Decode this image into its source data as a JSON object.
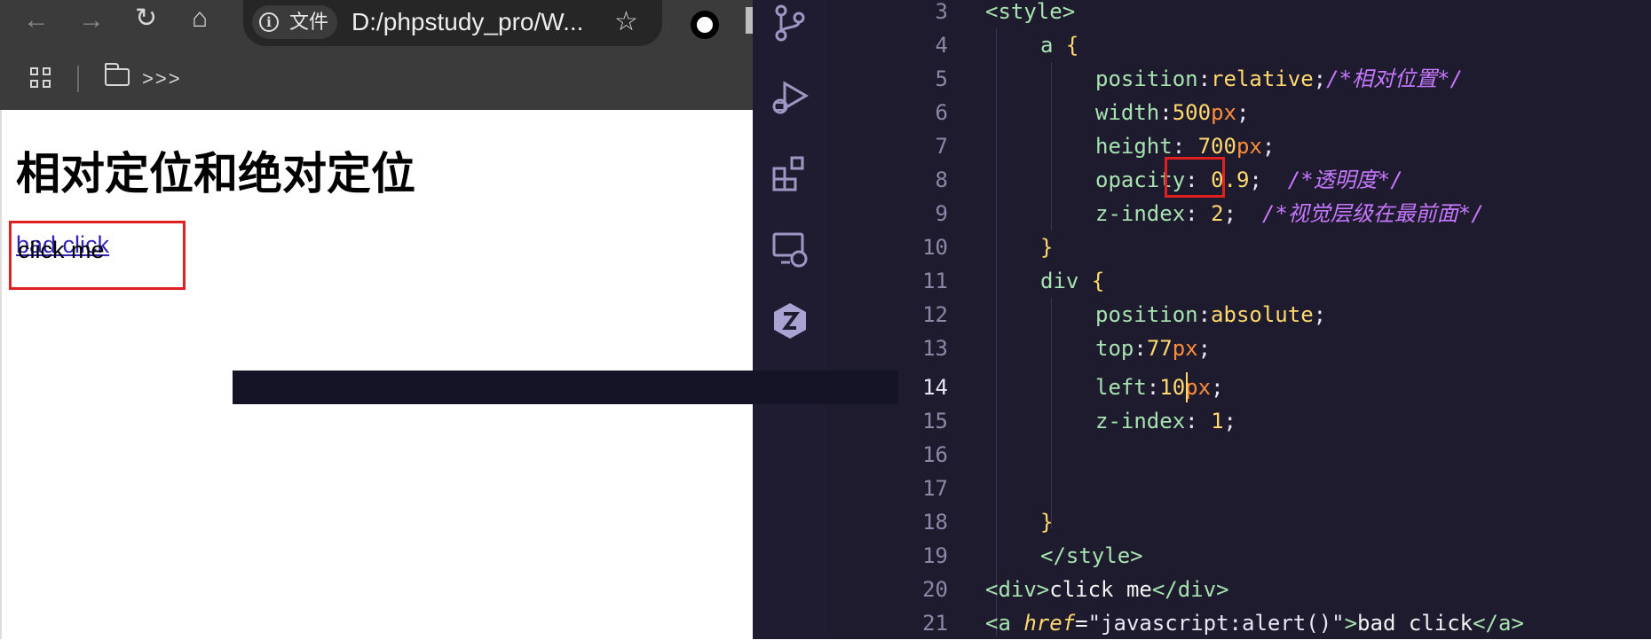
{
  "browser": {
    "address_bar": {
      "info_label": "文件",
      "url": "D:/phpstudy_pro/W..."
    },
    "bookmarks_bar": {
      "more_label": ">>>"
    },
    "page": {
      "heading": "相对定位和绝对定位",
      "link_text": "bad click",
      "div_text": "click me"
    }
  },
  "editor": {
    "line_numbers": [
      "3",
      "4",
      "5",
      "6",
      "7",
      "8",
      "9",
      "10",
      "11",
      "12",
      "13",
      "14",
      "15",
      "16",
      "17",
      "18",
      "19",
      "20",
      "21"
    ],
    "active_line": "14",
    "code": {
      "l3": {
        "tag": "<style>"
      },
      "l4": {
        "sel": "a",
        "brace": "{"
      },
      "l5": {
        "prop": "position",
        "val": "relative",
        "cmt": "/*相对位置*/"
      },
      "l6": {
        "prop": "width",
        "num": "500",
        "unit": "px"
      },
      "l7": {
        "prop": "height",
        "num": "700",
        "unit": "px"
      },
      "l8": {
        "prop": "opacity",
        "num": "0.9",
        "cmt": "/*透明度*/"
      },
      "l9": {
        "prop": "z-index",
        "num": "2",
        "cmt": "/*视觉层级在最前面*/"
      },
      "l10": {
        "brace": "}"
      },
      "l11": {
        "sel": "div",
        "brace": "{"
      },
      "l12": {
        "prop": "position",
        "val": "absolute"
      },
      "l13": {
        "prop": "top",
        "num": "77",
        "unit": "px"
      },
      "l14": {
        "prop": "left",
        "num": "10",
        "unit": "px"
      },
      "l15": {
        "prop": "z-index",
        "num": "1"
      },
      "l18": {
        "brace": "}"
      },
      "l19": {
        "tag": "</style>"
      },
      "l20": {
        "open": "<div>",
        "text": "click me",
        "close": "</div>"
      },
      "l21": {
        "open": "<a",
        "attr": "href",
        "eq": "=",
        "str": "\"javascript:alert()\"",
        "gt": ">",
        "text": "bad click",
        "close": "</a>"
      }
    }
  },
  "colors": {
    "editor_bg": "#1e1b2e",
    "keyword_green": "#a7e3b0",
    "number_yellow": "#ffd86e",
    "unit_orange": "#ff8d3a",
    "comment_purple": "#c678ff",
    "highlight_red": "#e02020",
    "link_blue": "#1a0dab"
  },
  "icons": {
    "toolbar": [
      "back-arrow-icon",
      "forward-arrow-icon",
      "reload-icon",
      "home-icon",
      "info-icon",
      "star-icon",
      "extension-icon"
    ],
    "activity_bar": [
      "source-control-icon",
      "run-debug-icon",
      "extensions-icon",
      "remote-explorer-icon",
      "app-logo-icon"
    ]
  }
}
